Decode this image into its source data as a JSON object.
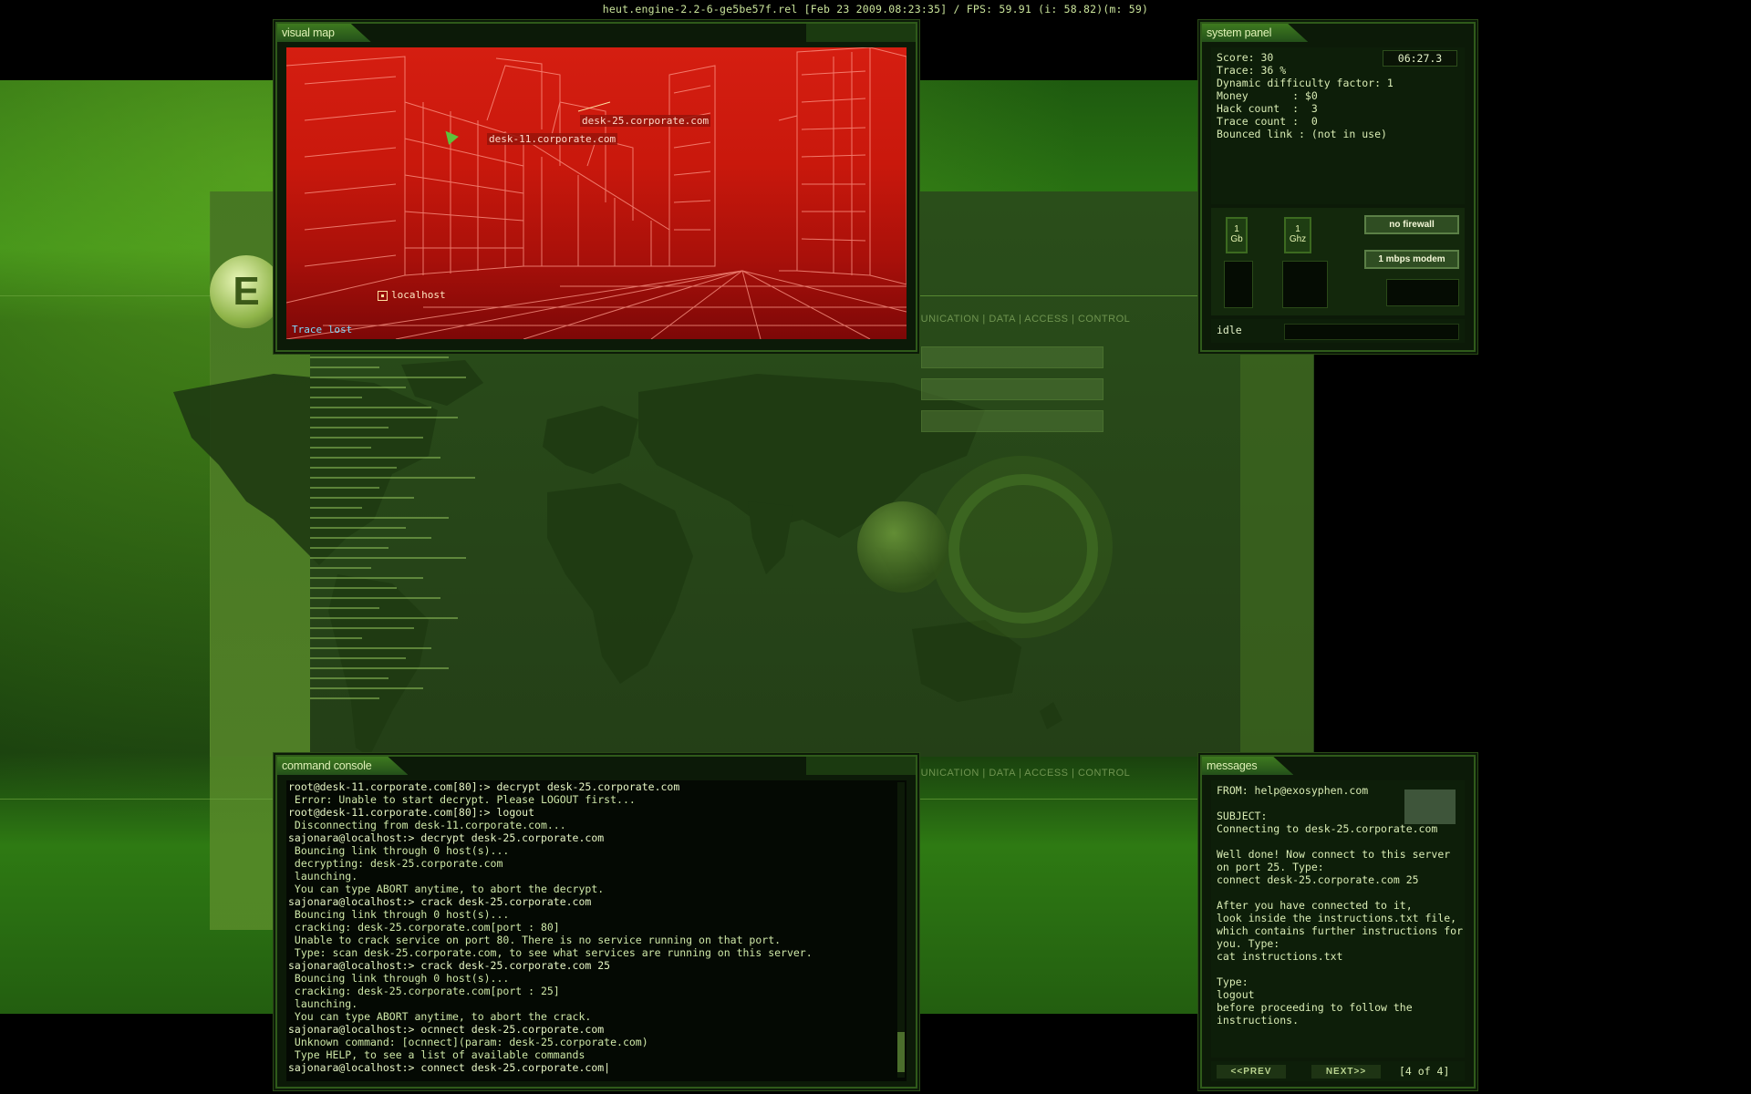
{
  "top_status": "heut.engine-2.2-6-ge5be57f.rel [Feb 23 2009.08:23:35] / FPS: 59.91 (i: 58.82)(m:  59)",
  "background": {
    "logo_letter": "E",
    "tag_upper": "MUNICATION | DATA | ACCESS | CONTROL",
    "tag_lower": "MUNICATION | DATA | ACCESS | CONTROL"
  },
  "visual_map": {
    "title": "visual map",
    "nodes": {
      "desk25": "desk-25.corporate.com",
      "desk11": "desk-11.corporate.com",
      "localhost": "localhost"
    },
    "trace_status": "Trace lost"
  },
  "system_panel": {
    "title": "system panel",
    "clock": "06:27.3",
    "stats": [
      "Score: 30",
      "Trace: 36 %",
      "Dynamic difficulty factor: 1",
      "Money       : $0",
      "Hack count  :  3",
      "Trace count :  0",
      "",
      "Bounced link : (not in use)"
    ],
    "memory_chip": {
      "value": "1",
      "unit": "Gb"
    },
    "cpu_chip": {
      "value": "1",
      "unit": "Ghz"
    },
    "firewall_label": "no firewall",
    "modem_label": "1 mbps modem",
    "status": "idle"
  },
  "command_console": {
    "title": "command console",
    "lines": [
      {
        "text": "root@desk-11.corporate.com[80]:> decrypt desk-25.corporate.com",
        "kind": "cmd"
      },
      {
        "text": " Error: Unable to start decrypt. Please LOGOUT first...",
        "kind": "out"
      },
      {
        "text": "root@desk-11.corporate.com[80]:> logout",
        "kind": "cmd"
      },
      {
        "text": " Disconnecting from desk-11.corporate.com...",
        "kind": "out"
      },
      {
        "text": "sajonara@localhost:> decrypt desk-25.corporate.com",
        "kind": "cmd"
      },
      {
        "text": " Bouncing link through 0 host(s)...",
        "kind": "out"
      },
      {
        "text": " decrypting: desk-25.corporate.com",
        "kind": "out"
      },
      {
        "text": " launching.",
        "kind": "out"
      },
      {
        "text": " You can type ABORT anytime, to abort the decrypt.",
        "kind": "out"
      },
      {
        "text": "sajonara@localhost:> crack desk-25.corporate.com",
        "kind": "cmd"
      },
      {
        "text": " Bouncing link through 0 host(s)...",
        "kind": "out"
      },
      {
        "text": " cracking: desk-25.corporate.com[port : 80]",
        "kind": "out"
      },
      {
        "text": " Unable to crack service on port 80. There is no service running on that port.",
        "kind": "out"
      },
      {
        "text": " Type: scan desk-25.corporate.com, to see what services are running on this server.",
        "kind": "out"
      },
      {
        "text": "sajonara@localhost:> crack desk-25.corporate.com 25",
        "kind": "cmd"
      },
      {
        "text": " Bouncing link through 0 host(s)...",
        "kind": "out"
      },
      {
        "text": " cracking: desk-25.corporate.com[port : 25]",
        "kind": "out"
      },
      {
        "text": " launching.",
        "kind": "out"
      },
      {
        "text": " You can type ABORT anytime, to abort the crack.",
        "kind": "out"
      },
      {
        "text": "sajonara@localhost:> ocnnect desk-25.corporate.com",
        "kind": "cmd"
      },
      {
        "text": " Unknown command: [ocnnect](param: desk-25.corporate.com)",
        "kind": "out"
      },
      {
        "text": " Type HELP, to see a list of available commands",
        "kind": "out"
      },
      {
        "text": "sajonara@localhost:> connect desk-25.corporate.com|",
        "kind": "cmd"
      }
    ]
  },
  "messages": {
    "title": "messages",
    "lines": [
      "FROM: help@exosyphen.com",
      "",
      "SUBJECT:",
      "Connecting to desk-25.corporate.com",
      "",
      "Well done! Now connect to this server",
      "on port 25. Type:",
      "connect desk-25.corporate.com 25",
      "",
      "After you have connected to it,",
      "look inside the instructions.txt file,",
      "which contains further instructions for",
      "you. Type:",
      "cat instructions.txt",
      "",
      "Type:",
      "logout",
      "before proceeding to follow the",
      "instructions."
    ],
    "prev_label": "<<PREV",
    "next_label": "NEXT>>",
    "page": "[4 of 4]"
  }
}
